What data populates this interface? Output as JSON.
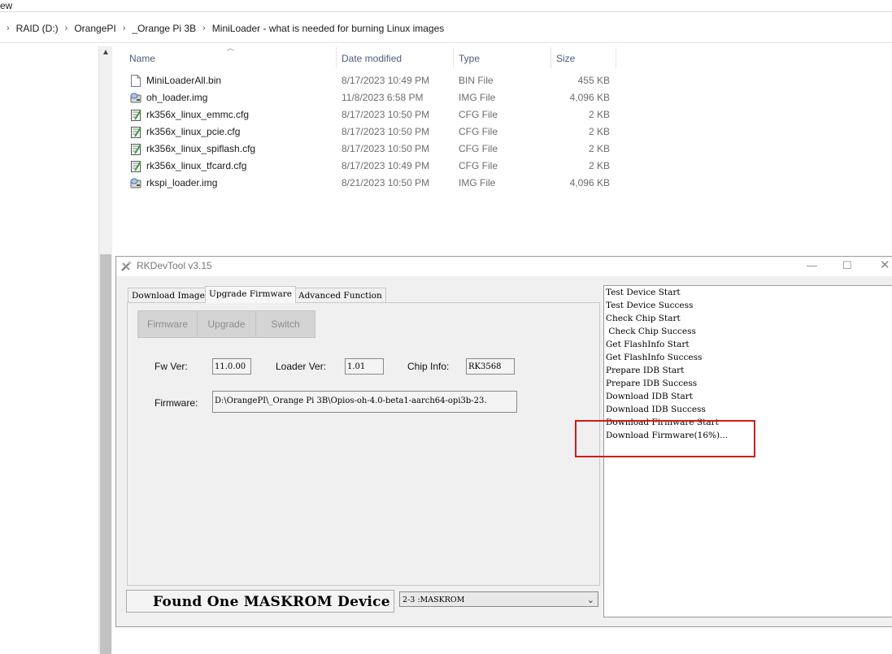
{
  "explorer": {
    "menu_fragment": "ew",
    "breadcrumb": [
      "RAID (D:)",
      "OrangePI",
      "_Orange Pi 3B",
      "MiniLoader - what is needed for burning Linux images"
    ],
    "columns": {
      "name": "Name",
      "date": "Date modified",
      "type": "Type",
      "size": "Size"
    },
    "files": [
      {
        "name": "MiniLoaderAll.bin",
        "date": "8/17/2023 10:49 PM",
        "type": "BIN File",
        "size": "455 KB",
        "icon": "blank-file-icon"
      },
      {
        "name": "oh_loader.img",
        "date": "11/8/2023 6:58 PM",
        "type": "IMG File",
        "size": "4,096 KB",
        "icon": "disk-image-icon"
      },
      {
        "name": "rk356x_linux_emmc.cfg",
        "date": "8/17/2023 10:50 PM",
        "type": "CFG File",
        "size": "2 KB",
        "icon": "config-file-icon"
      },
      {
        "name": "rk356x_linux_pcie.cfg",
        "date": "8/17/2023 10:50 PM",
        "type": "CFG File",
        "size": "2 KB",
        "icon": "config-file-icon"
      },
      {
        "name": "rk356x_linux_spiflash.cfg",
        "date": "8/17/2023 10:50 PM",
        "type": "CFG File",
        "size": "2 KB",
        "icon": "config-file-icon"
      },
      {
        "name": "rk356x_linux_tfcard.cfg",
        "date": "8/17/2023 10:49 PM",
        "type": "CFG File",
        "size": "2 KB",
        "icon": "config-file-icon"
      },
      {
        "name": "rkspi_loader.img",
        "date": "8/21/2023 10:50 PM",
        "type": "IMG File",
        "size": "4,096 KB",
        "icon": "disk-image-icon"
      }
    ]
  },
  "dialog": {
    "title": "RKDevTool v3.15",
    "tabs": [
      "Download Image",
      "Upgrade Firmware",
      "Advanced Function"
    ],
    "active_tab": "Upgrade Firmware",
    "buttons": {
      "firmware": "Firmware",
      "upgrade": "Upgrade",
      "switch": "Switch"
    },
    "fw_ver_label": "Fw Ver:",
    "fw_ver": "11.0.00",
    "loader_ver_label": "Loader Ver:",
    "loader_ver": "1.01",
    "chip_info_label": "Chip Info:",
    "chip_info": "RK3568",
    "firmware_label": "Firmware:",
    "firmware_path": "D:\\OrangePI\\_Orange Pi 3B\\Opios-oh-4.0-beta1-aarch64-opi3b-23.",
    "log": [
      "Test Device Start",
      "Test Device Success",
      "Check Chip Start",
      " Check Chip Success",
      "Get FlashInfo Start",
      "Get FlashInfo Success",
      "Prepare IDB Start",
      "Prepare IDB Success",
      "Download IDB Start",
      "Download IDB Success",
      "Download Firmware Start",
      "Download Firmware(16%)..."
    ],
    "status": "Found One MASKROM Device",
    "device_select": "2-3 :MASKROM"
  },
  "colors": {
    "highlight": "#d11b1b",
    "header_text": "#4c607a"
  }
}
